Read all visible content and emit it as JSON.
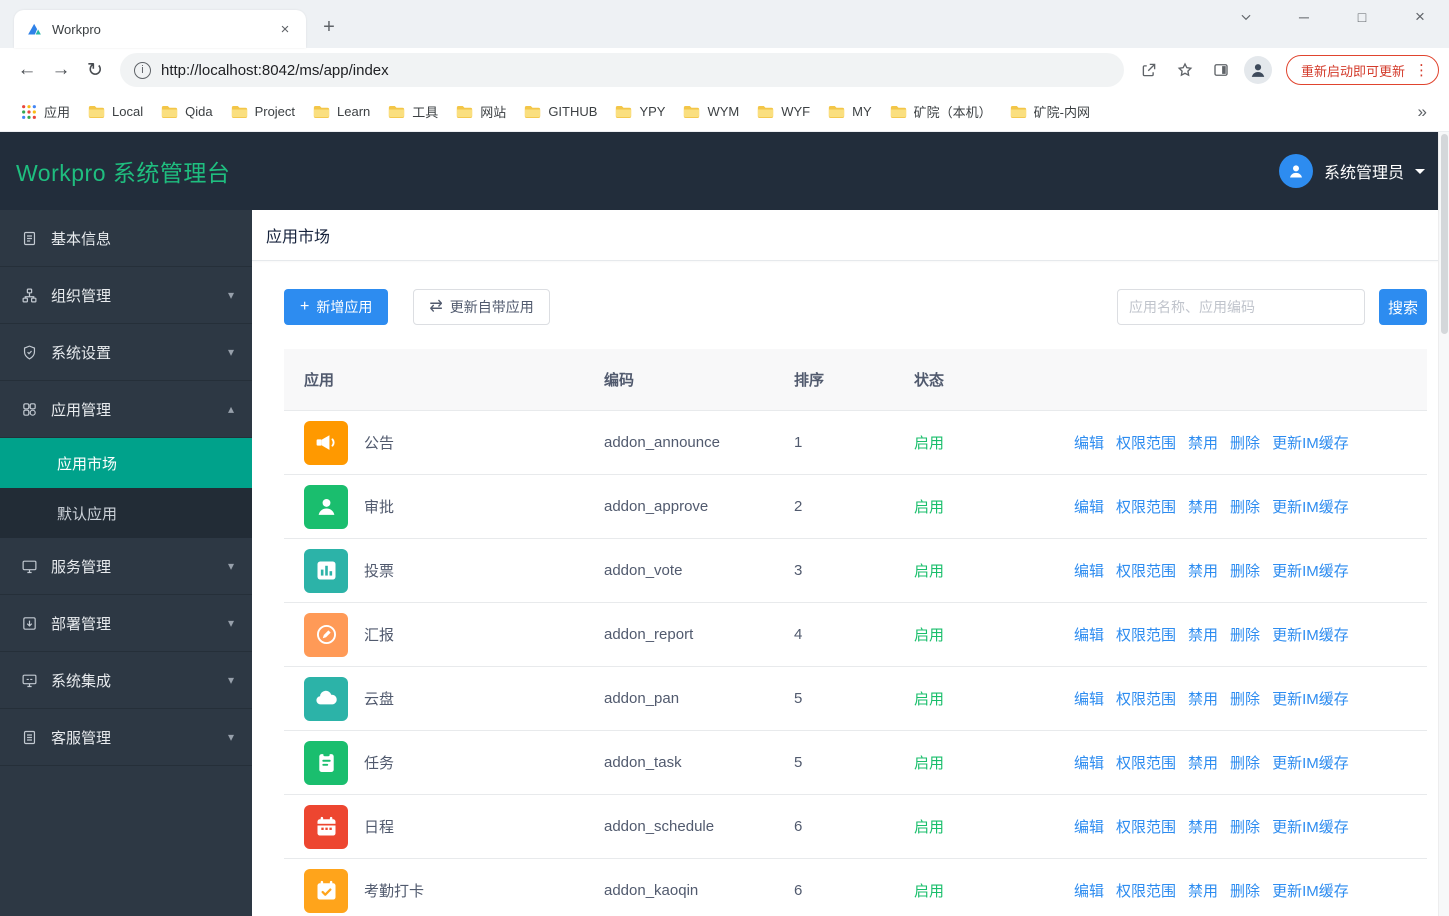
{
  "icons": {
    "back": "←",
    "forward": "→",
    "reload": "↻",
    "info": "i",
    "new_tab": "+",
    "tab_close": "×",
    "window_minimize": "─",
    "window_maximize": "□",
    "window_close": "×",
    "overflow": "»",
    "dots_vertical": "⋮",
    "caret_down": "▾",
    "caret_up": "▴",
    "plus": "+",
    "swap": "⇄"
  },
  "colors": {
    "accent_blue": "#2d8cf0",
    "success_green": "#19be6b",
    "sidebar_active": "#00a28b",
    "brand_green": "#1fbe7f",
    "update_red": "#d33a2a",
    "header_bg": "#222d3b",
    "sidebar_bg": "#2d3844"
  },
  "browser": {
    "tab": {
      "title": "Workpro"
    },
    "address": {
      "url": "http://localhost:8042/ms/app/index"
    },
    "update_button": {
      "label": "重新启动即可更新"
    },
    "bookmarks": [
      {
        "label": "应用",
        "icon": "apps-grid-icon"
      },
      {
        "label": "Local",
        "icon": "folder-icon"
      },
      {
        "label": "Qida",
        "icon": "folder-icon"
      },
      {
        "label": "Project",
        "icon": "folder-icon"
      },
      {
        "label": "Learn",
        "icon": "folder-icon"
      },
      {
        "label": "工具",
        "icon": "folder-icon"
      },
      {
        "label": "网站",
        "icon": "folder-icon"
      },
      {
        "label": "GITHUB",
        "icon": "folder-icon"
      },
      {
        "label": "YPY",
        "icon": "folder-icon"
      },
      {
        "label": "WYM",
        "icon": "folder-icon"
      },
      {
        "label": "WYF",
        "icon": "folder-icon"
      },
      {
        "label": "MY",
        "icon": "folder-icon"
      },
      {
        "label": "矿院（本机）",
        "icon": "folder-icon"
      },
      {
        "label": "矿院-内网",
        "icon": "folder-icon"
      }
    ]
  },
  "header": {
    "title": "Workpro 系统管理台",
    "user_name": "系统管理员"
  },
  "sidebar": {
    "items": [
      {
        "label": "基本信息",
        "icon": "document-icon",
        "expandable": false
      },
      {
        "label": "组织管理",
        "icon": "org-icon",
        "expandable": true
      },
      {
        "label": "系统设置",
        "icon": "shield-icon",
        "expandable": true
      },
      {
        "label": "应用管理",
        "icon": "apps-icon",
        "expandable": true,
        "expanded": true,
        "children": [
          {
            "label": "应用市场",
            "active": true
          },
          {
            "label": "默认应用",
            "active": false
          }
        ]
      },
      {
        "label": "服务管理",
        "icon": "monitor-icon",
        "expandable": true
      },
      {
        "label": "部署管理",
        "icon": "deploy-icon",
        "expandable": true
      },
      {
        "label": "系统集成",
        "icon": "integration-icon",
        "expandable": true
      },
      {
        "label": "客服管理",
        "icon": "support-icon",
        "expandable": true
      }
    ]
  },
  "main": {
    "page_title": "应用市场",
    "toolbar": {
      "add_button": "新增应用",
      "update_button": "更新自带应用",
      "search_placeholder": "应用名称、应用编码",
      "search_button": "搜索"
    },
    "table": {
      "headers": [
        "应用",
        "编码",
        "排序",
        "状态"
      ],
      "actions": [
        "编辑",
        "权限范围",
        "禁用",
        "删除",
        "更新IM缓存"
      ],
      "rows": [
        {
          "name": "公告",
          "code": "addon_announce",
          "order": "1",
          "status": "启用",
          "icon": "announce-icon",
          "icon_color": "#ff9900"
        },
        {
          "name": "审批",
          "code": "addon_approve",
          "order": "2",
          "status": "启用",
          "icon": "approve-icon",
          "icon_color": "#1abe6e"
        },
        {
          "name": "投票",
          "code": "addon_vote",
          "order": "3",
          "status": "启用",
          "icon": "vote-icon",
          "icon_color": "#2cb3a8"
        },
        {
          "name": "汇报",
          "code": "addon_report",
          "order": "4",
          "status": "启用",
          "icon": "report-icon",
          "icon_color": "#ff9a57"
        },
        {
          "name": "云盘",
          "code": "addon_pan",
          "order": "5",
          "status": "启用",
          "icon": "pan-icon",
          "icon_color": "#2cb3a8"
        },
        {
          "name": "任务",
          "code": "addon_task",
          "order": "5",
          "status": "启用",
          "icon": "task-icon",
          "icon_color": "#1abe6e"
        },
        {
          "name": "日程",
          "code": "addon_schedule",
          "order": "6",
          "status": "启用",
          "icon": "schedule-icon",
          "icon_color": "#ed4630"
        },
        {
          "name": "考勤打卡",
          "code": "addon_kaoqin",
          "order": "6",
          "status": "启用",
          "icon": "kaoqin-icon",
          "icon_color": "#ffa41b"
        }
      ]
    }
  }
}
